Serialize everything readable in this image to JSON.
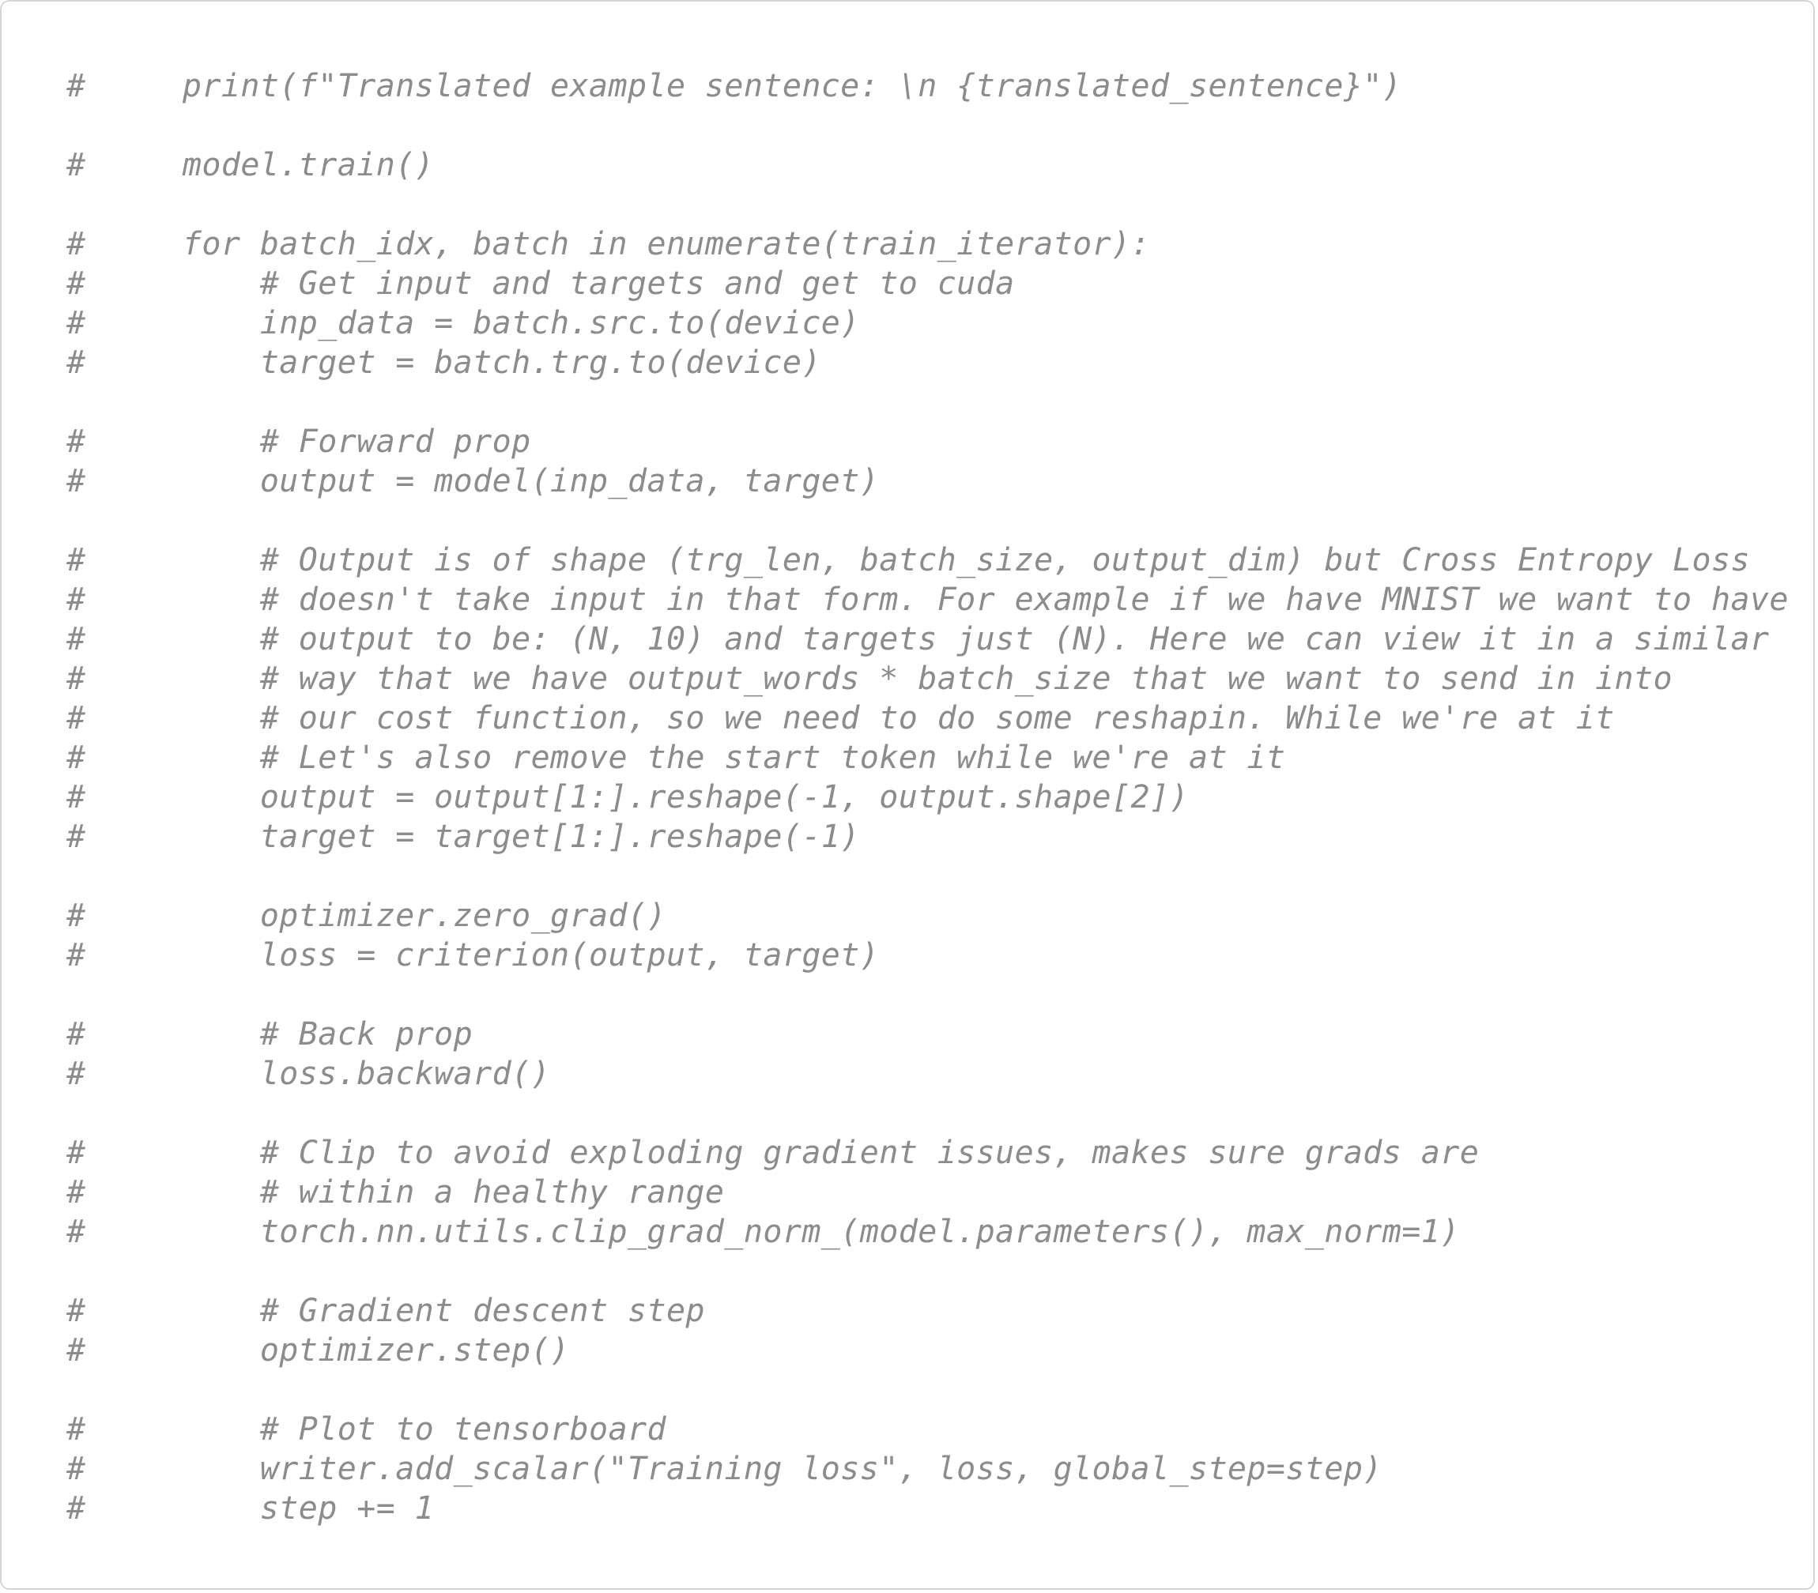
{
  "code": {
    "lines": [
      "#     print(f\"Translated example sentence: \\n {translated_sentence}\")",
      "",
      "#     model.train()",
      "",
      "#     for batch_idx, batch in enumerate(train_iterator):",
      "#         # Get input and targets and get to cuda",
      "#         inp_data = batch.src.to(device)",
      "#         target = batch.trg.to(device)",
      "",
      "#         # Forward prop",
      "#         output = model(inp_data, target)",
      "",
      "#         # Output is of shape (trg_len, batch_size, output_dim) but Cross Entropy Loss",
      "#         # doesn't take input in that form. For example if we have MNIST we want to have",
      "#         # output to be: (N, 10) and targets just (N). Here we can view it in a similar",
      "#         # way that we have output_words * batch_size that we want to send in into",
      "#         # our cost function, so we need to do some reshapin. While we're at it",
      "#         # Let's also remove the start token while we're at it",
      "#         output = output[1:].reshape(-1, output.shape[2])",
      "#         target = target[1:].reshape(-1)",
      "",
      "#         optimizer.zero_grad()",
      "#         loss = criterion(output, target)",
      "",
      "#         # Back prop",
      "#         loss.backward()",
      "",
      "#         # Clip to avoid exploding gradient issues, makes sure grads are",
      "#         # within a healthy range",
      "#         torch.nn.utils.clip_grad_norm_(model.parameters(), max_norm=1)",
      "",
      "#         # Gradient descent step",
      "#         optimizer.step()",
      "",
      "#         # Plot to tensorboard",
      "#         writer.add_scalar(\"Training loss\", loss, global_step=step)",
      "#         step += 1"
    ]
  }
}
